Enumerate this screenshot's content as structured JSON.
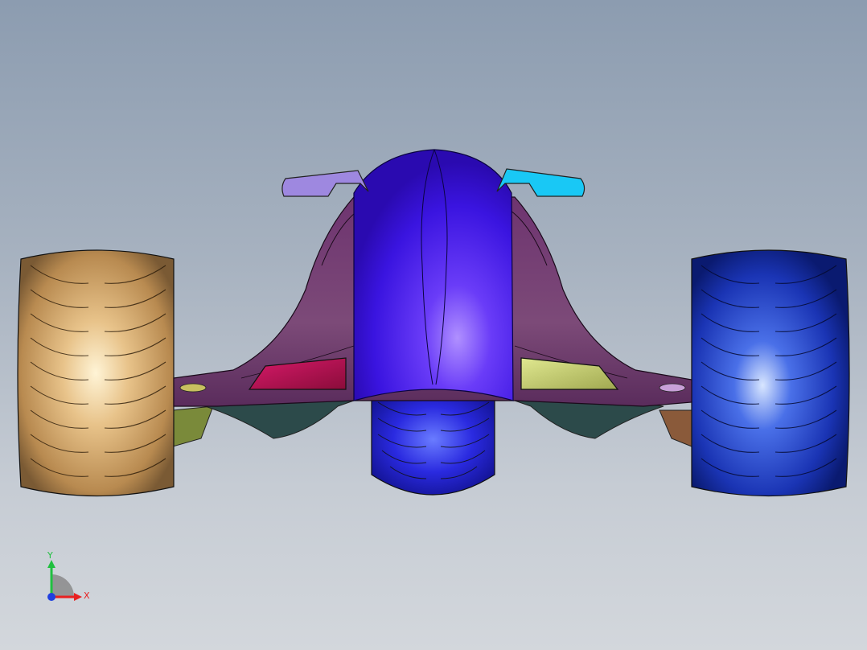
{
  "viewport": {
    "background_top": "#8c9cb0",
    "background_bottom": "#d3d7dc"
  },
  "model": {
    "parts": [
      {
        "name": "left-rear-wheel",
        "color": "#c8a060"
      },
      {
        "name": "front-wheel",
        "color": "#2a2ae0"
      },
      {
        "name": "right-rear-wheel",
        "color": "#1e3cc8"
      },
      {
        "name": "body-shell",
        "color": "#6a3c6e"
      },
      {
        "name": "nose-cowl",
        "color": "#3a14e8"
      },
      {
        "name": "left-mirror",
        "color": "#9e88e0"
      },
      {
        "name": "right-mirror",
        "color": "#19c8f5"
      },
      {
        "name": "left-intake",
        "color": "#b0104e"
      },
      {
        "name": "right-intake",
        "color": "#c8d070"
      }
    ]
  },
  "triad": {
    "x_label": "X",
    "y_label": "Y",
    "x_color": "#e82020",
    "y_color": "#20c040",
    "z_color": "#2040e0"
  }
}
